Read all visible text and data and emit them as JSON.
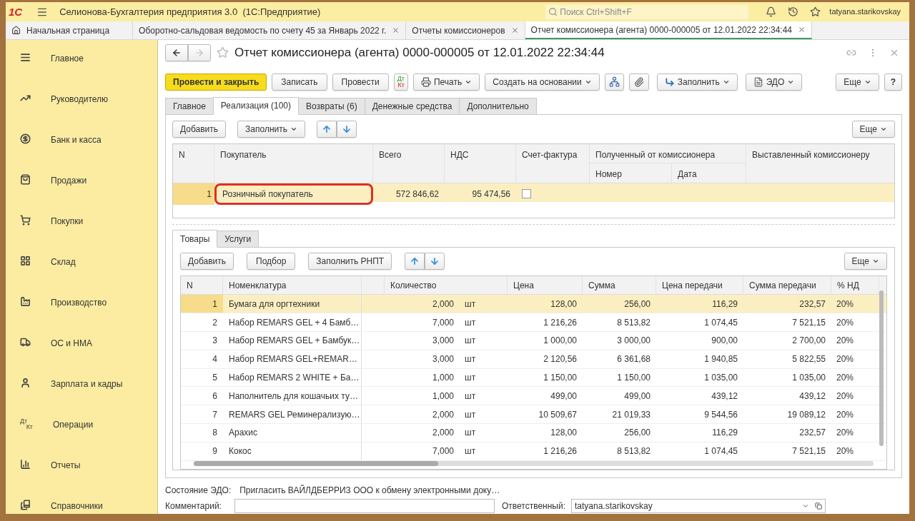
{
  "app": {
    "logo": "1С",
    "title": "Селионова-Бухгалтерия предприятия 3.0  (1С:Предприятие)",
    "search_placeholder": "Поиск Ctrl+Shift+F",
    "user": "tatyana.starikovskay"
  },
  "open_tabs": [
    {
      "label": "Начальная страница",
      "kind": "home",
      "selected": false
    },
    {
      "label": "Оборотно-сальдовая ведомость по счету 45 за Январь 2022 г.",
      "kind": "doc",
      "selected": false
    },
    {
      "label": "Отчеты комиссионеров",
      "kind": "doc",
      "selected": false
    },
    {
      "label": "Отчет комиссионера (агента) 0000-000005 от 12.01.2022 22:34:44",
      "kind": "doc",
      "selected": true
    }
  ],
  "sidebar": {
    "items": [
      {
        "label": "Главное"
      },
      {
        "label": "Руководителю"
      },
      {
        "label": "Банк и касса"
      },
      {
        "label": "Продажи"
      },
      {
        "label": "Покупки"
      },
      {
        "label": "Склад"
      },
      {
        "label": "Производство"
      },
      {
        "label": "ОС и НМА"
      },
      {
        "label": "Зарплата и кадры"
      },
      {
        "label": "Операции",
        "icon_text": [
          "Дт",
          "Кт"
        ]
      },
      {
        "label": "Отчеты"
      },
      {
        "label": "Справочники"
      }
    ]
  },
  "document": {
    "title": "Отчет комиссионера (агента) 0000-000005 от 12.01.2022 22:34:44",
    "toolbar": [
      {
        "kind": "primary",
        "label": "Провести и закрыть"
      },
      {
        "kind": "plain",
        "label": "Записать"
      },
      {
        "kind": "plain",
        "label": "Провести"
      },
      {
        "kind": "dtkt",
        "label": "Дт",
        "label2": "Кт"
      },
      {
        "kind": "print",
        "label": "Печать"
      },
      {
        "kind": "menu",
        "label": "Создать на основании"
      },
      {
        "kind": "structure"
      },
      {
        "kind": "attach"
      },
      {
        "kind": "fill",
        "label": "Заполнить"
      },
      {
        "kind": "edo",
        "label": "ЭДО"
      },
      {
        "kind": "more",
        "label": "Еще"
      },
      {
        "kind": "help",
        "label": "?"
      }
    ],
    "tabs": [
      {
        "label": "Главное",
        "selected": false
      },
      {
        "label": "Реализация (100)",
        "selected": true
      },
      {
        "label": "Возвраты (6)",
        "selected": false
      },
      {
        "label": "Денежные средства",
        "selected": false
      },
      {
        "label": "Дополнительно",
        "selected": false
      }
    ],
    "sales": {
      "buttons": {
        "add": "Добавить",
        "fill": "Заполнить",
        "more": "Еще"
      },
      "columns": {
        "n": "N",
        "buyer": "Покупатель",
        "total": "Всего",
        "vat": "НДС",
        "invoice": "Счет-фактура",
        "received": "Полученный от комиссионера",
        "number": "Номер",
        "date": "Дата",
        "issued": "Выставленный комиссионеру"
      },
      "rows": [
        {
          "n": "1",
          "buyer": "Розничный покупатель",
          "total": "572 846,62",
          "vat": "95 474,56",
          "invoice": false,
          "selected": true,
          "highlighted": true
        }
      ]
    },
    "subtabs": [
      {
        "label": "Товары",
        "selected": true
      },
      {
        "label": "Услуги",
        "selected": false
      }
    ],
    "goods": {
      "buttons": {
        "add": "Добавить",
        "pick": "Подбор",
        "fill": "Заполнить РНПТ",
        "more": "Еще"
      },
      "columns": {
        "n": "N",
        "name": "Номенклатура",
        "qty": "Количество",
        "price": "Цена",
        "sum": "Сумма",
        "transfer_price": "Цена передачи",
        "transfer_sum": "Сумма передачи",
        "vat_rate": "% НД"
      },
      "rows": [
        {
          "n": "1",
          "name": "Бумага для оргтехники",
          "qty": "2,000",
          "unit": "шт",
          "price": "128,00",
          "sum": "256,00",
          "transfer_price": "116,29",
          "transfer_sum": "232,57",
          "vat_rate": "20%",
          "selected": true
        },
        {
          "n": "2",
          "name": "Набор REMARS GEL + 4 Бамб…",
          "qty": "7,000",
          "unit": "шт",
          "price": "1 216,26",
          "sum": "8 513,82",
          "transfer_price": "1 074,45",
          "transfer_sum": "7 521,15",
          "vat_rate": "20%",
          "selected": false
        },
        {
          "n": "3",
          "name": "Набор REMARS GEL + Бамбук…",
          "qty": "3,000",
          "unit": "шт",
          "price": "1 000,00",
          "sum": "3 000,00",
          "transfer_price": "900,00",
          "transfer_sum": "2 700,00",
          "vat_rate": "20%",
          "selected": false
        },
        {
          "n": "4",
          "name": "Набор REMARS GEL+REMAR…",
          "qty": "3,000",
          "unit": "шт",
          "price": "2 120,56",
          "sum": "6 361,68",
          "transfer_price": "1 940,85",
          "transfer_sum": "5 822,55",
          "vat_rate": "20%",
          "selected": false
        },
        {
          "n": "5",
          "name": "Набор REMARS 2 WHITE + Ба…",
          "qty": "1,000",
          "unit": "шт",
          "price": "1 150,00",
          "sum": "1 150,00",
          "transfer_price": "1 035,00",
          "transfer_sum": "1 035,00",
          "vat_rate": "20%",
          "selected": false
        },
        {
          "n": "6",
          "name": "Наполнитель для кошачьих ту…",
          "qty": "1,000",
          "unit": "шт",
          "price": "499,00",
          "sum": "499,00",
          "transfer_price": "439,12",
          "transfer_sum": "439,12",
          "vat_rate": "20%",
          "selected": false
        },
        {
          "n": "7",
          "name": "REMARS GEL Реминерализую…",
          "qty": "2,000",
          "unit": "шт",
          "price": "10 509,67",
          "sum": "21 019,33",
          "transfer_price": "9 544,56",
          "transfer_sum": "19 089,12",
          "vat_rate": "20%",
          "selected": false
        },
        {
          "n": "8",
          "name": "Арахис",
          "qty": "2,000",
          "unit": "шт",
          "price": "128,00",
          "sum": "256,00",
          "transfer_price": "116,29",
          "transfer_sum": "232,57",
          "vat_rate": "20%",
          "selected": false
        },
        {
          "n": "9",
          "name": "Кокос",
          "qty": "7,000",
          "unit": "шт",
          "price": "1 216,26",
          "sum": "8 513,82",
          "transfer_price": "1 074,45",
          "transfer_sum": "7 521,15",
          "vat_rate": "20%",
          "selected": false
        }
      ]
    },
    "footer": {
      "edo_label": "Состояние ЭДО:",
      "edo_value": "Пригласить ВАЙЛДБЕРРИЗ ООО к обмену электронными доку…",
      "comment_label": "Комментарий:",
      "responsible_label": "Ответственный:",
      "responsible_value": "tatyana.starikovskay"
    }
  }
}
